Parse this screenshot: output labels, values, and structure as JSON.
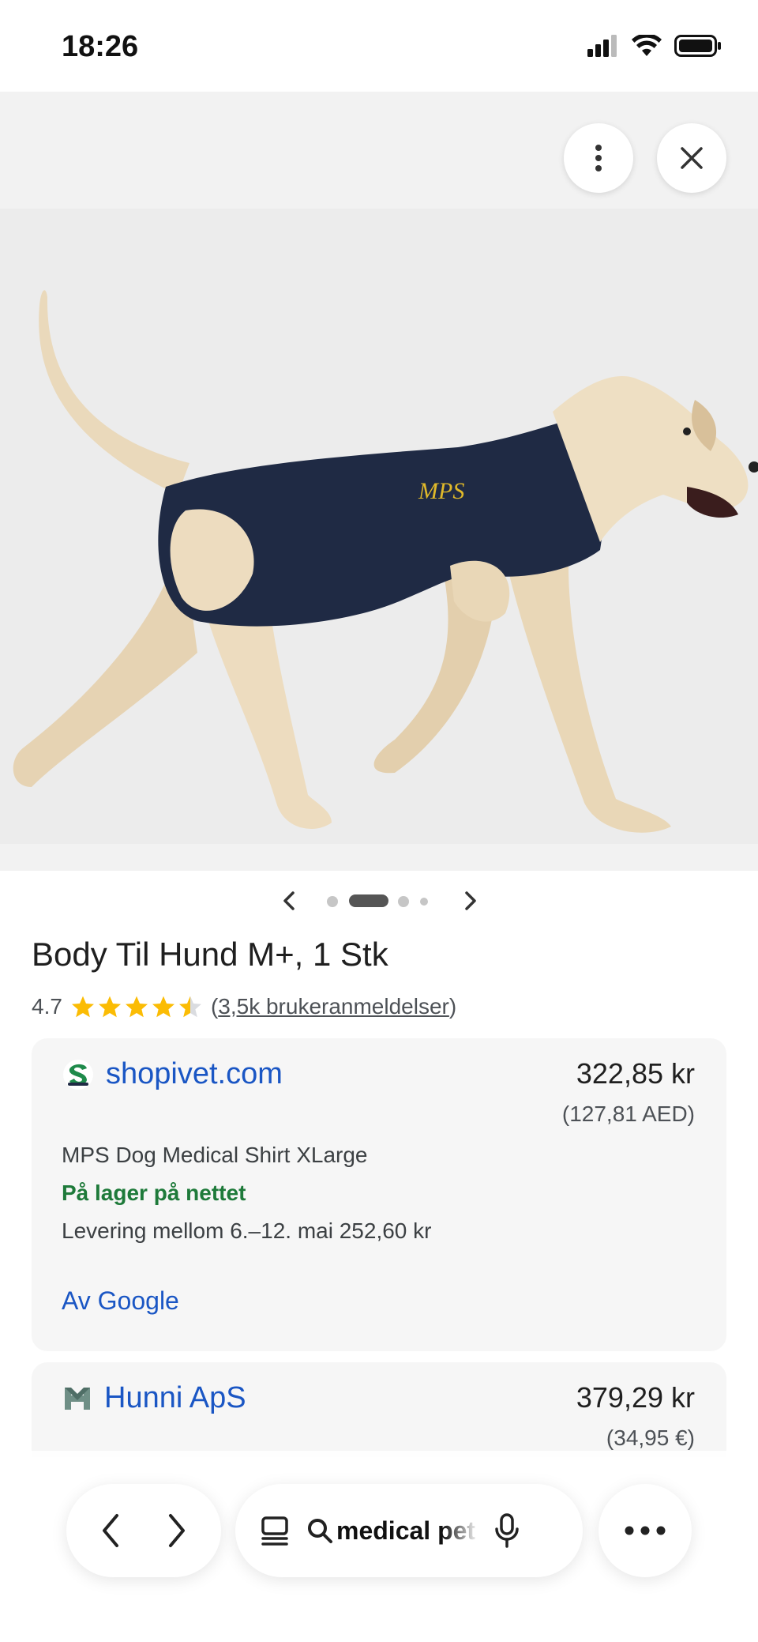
{
  "status_bar": {
    "time": "18:26"
  },
  "product": {
    "title": "Body Til Hund M+, 1 Stk",
    "rating": "4.7",
    "stars_filled": 4.5,
    "reviews_prefix": "(",
    "reviews_text": "3,5k brukeranmeldelser",
    "reviews_suffix": ")",
    "image_logo_text": "MPS"
  },
  "carousel": {
    "total": 4,
    "active": 1
  },
  "offers": [
    {
      "seller": "shopivet.com",
      "price": "322,85 kr",
      "price_alt": "(127,81 AED)",
      "item": "MPS Dog Medical Shirt XLarge",
      "stock": "På lager på nettet",
      "delivery": "Levering mellom 6.–12. mai 252,60 kr",
      "source_link": "Av Google"
    },
    {
      "seller": "Hunni ApS",
      "price": "379,29 kr",
      "price_alt": "(34,95 €)"
    }
  ],
  "toolbar": {
    "url": "medical pet"
  },
  "colors": {
    "link": "#1a56c4",
    "stock_green": "#1e7a3a",
    "star": "#fbbc04",
    "shirt": "#1f2a44"
  },
  "icons": [
    "signal-icon",
    "wifi-icon",
    "battery-icon",
    "more-vertical-icon",
    "close-icon",
    "chevron-left-icon",
    "chevron-right-icon",
    "star-icon",
    "tabs-icon",
    "search-icon",
    "microphone-icon",
    "more-horizontal-icon"
  ]
}
